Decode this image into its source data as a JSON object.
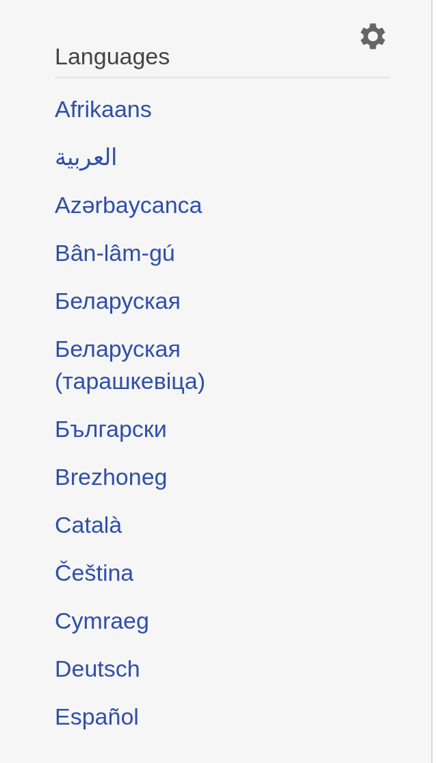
{
  "portlet": {
    "heading": "Languages",
    "languages": [
      "Afrikaans",
      "العربية",
      "Azərbaycanca",
      "Bân-lâm-gú",
      "Беларуская",
      "Беларуская (тарашкевіца)",
      "Български",
      "Brezhoneg",
      "Català",
      "Čeština",
      "Cymraeg",
      "Deutsch",
      "Español"
    ]
  }
}
